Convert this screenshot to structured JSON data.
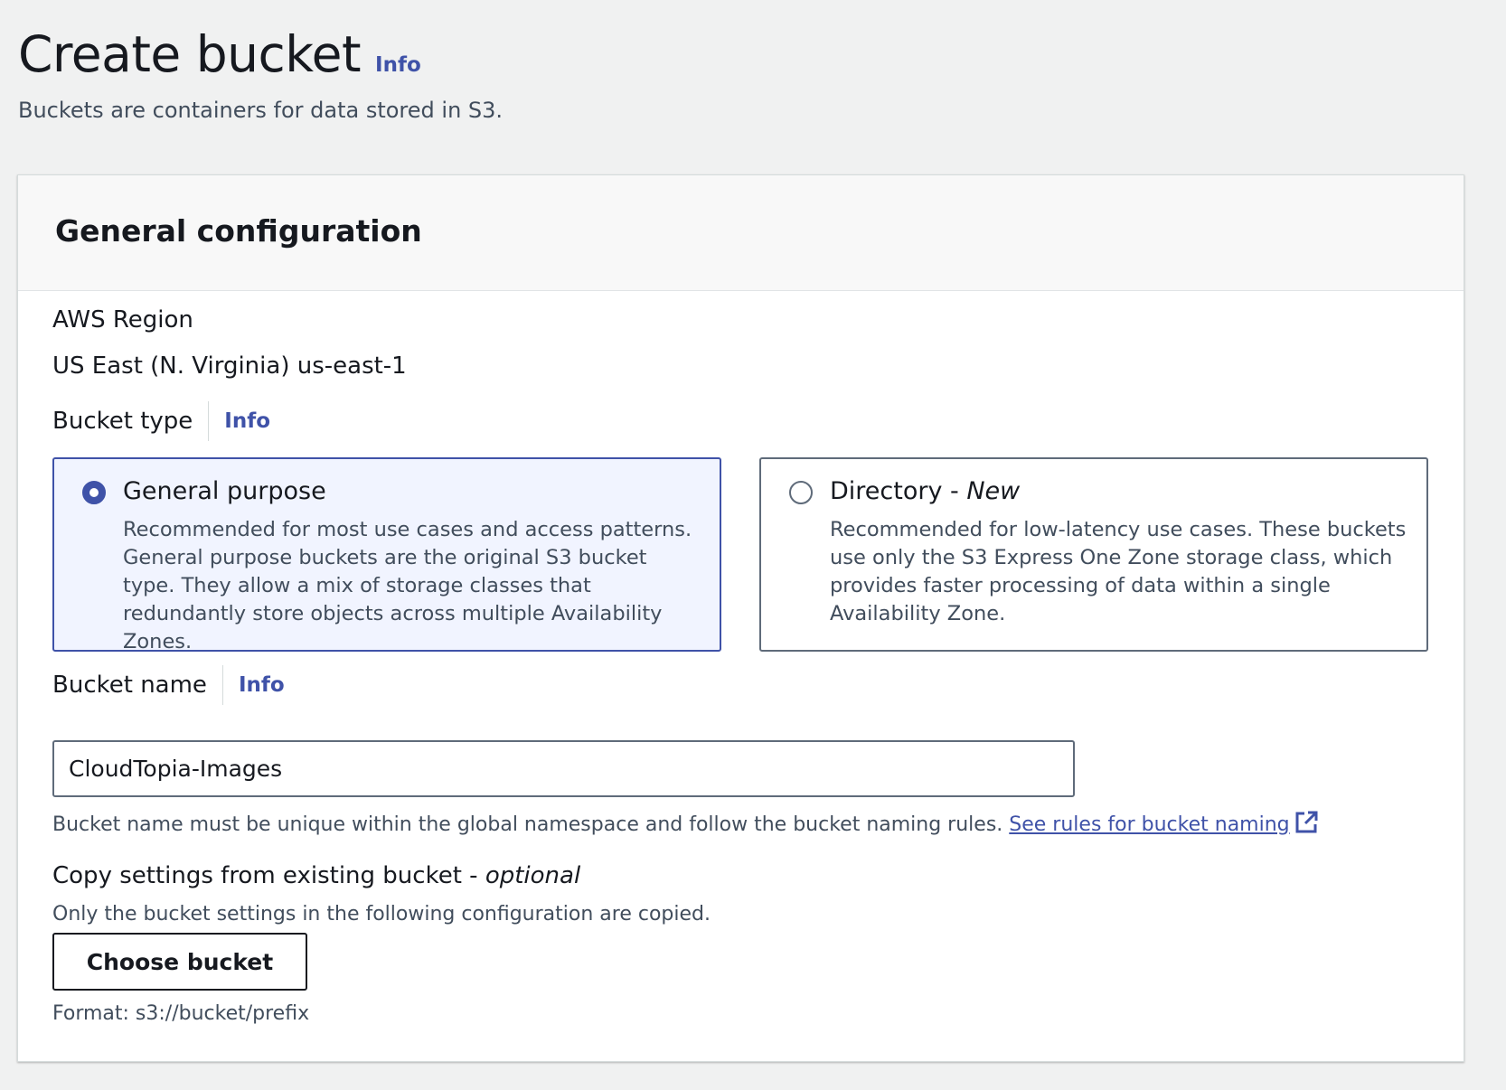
{
  "header": {
    "title": "Create bucket",
    "info_label": "Info",
    "description": "Buckets are containers for data stored in S3."
  },
  "panel": {
    "title": "General configuration",
    "region": {
      "label": "AWS Region",
      "value": "US East (N. Virginia) us-east-1"
    },
    "bucket_type": {
      "label": "Bucket type",
      "info_label": "Info",
      "selected": "general-purpose",
      "options": [
        {
          "id": "general-purpose",
          "title": "General purpose",
          "description": "Recommended for most use cases and access patterns. General purpose buckets are the original S3 bucket type. They allow a mix of storage classes that redundantly store objects across multiple Availability Zones."
        },
        {
          "id": "directory",
          "title": "Directory - ",
          "title_suffix": "New",
          "description": "Recommended for low-latency use cases. These buckets use only the S3 Express One Zone storage class, which provides faster processing of data within a single Availability Zone."
        }
      ]
    },
    "bucket_name": {
      "label": "Bucket name",
      "info_label": "Info",
      "value": "CloudTopia-Images",
      "hint": "Bucket name must be unique within the global namespace and follow the bucket naming rules.",
      "link_text": "See rules for bucket naming"
    },
    "copy_settings": {
      "label": "Copy settings from existing bucket - ",
      "label_suffix": "optional",
      "description": "Only the bucket settings in the following configuration are copied.",
      "button_label": "Choose bucket",
      "format_hint": "Format: s3://bucket/prefix"
    }
  },
  "colors": {
    "accent": "#3f52a8",
    "page_background": "#f0f1f1",
    "selected_tile_background": "#f1f4ff"
  }
}
